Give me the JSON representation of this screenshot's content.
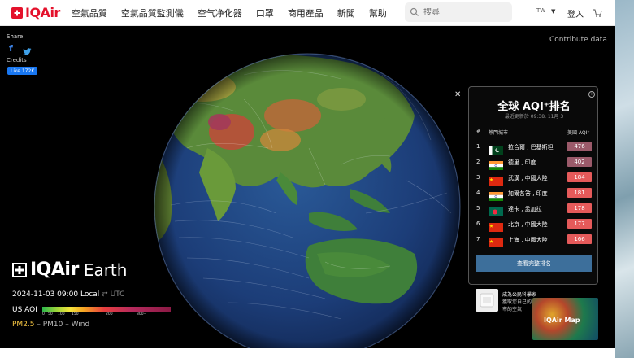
{
  "header": {
    "logo_text": "IQAir",
    "nav": [
      "空氣品質",
      "空氣品質監測儀",
      "空气净化器",
      "口罩",
      "商用產品",
      "新聞",
      "幫助"
    ],
    "search_placeholder": "搜尋",
    "lang": "TW",
    "login": "登入"
  },
  "left": {
    "share": "Share",
    "credits": "Credits",
    "like": "Like 172K",
    "brand": "IQAir",
    "brand_sub": "Earth",
    "datetime": "2024-11-03 09:00 Local",
    "utc": "⇄ UTC",
    "aqi_label": "US AQI",
    "scale_ticks": [
      "0",
      "50",
      "100",
      "150",
      "200",
      "300+"
    ],
    "pollutant_active": "PM2.5",
    "pollutant_rest": " – PM10 – Wind"
  },
  "contribute": "Contribute data",
  "ranking": {
    "title": "全球 AQI⁺排名",
    "updated": "最近更新於 09:38, 11月 3",
    "head_num": "#",
    "head_city": "熱門城市",
    "head_aqi": "美國 AQI⁺",
    "rows": [
      {
        "rank": "1",
        "city": "拉合爾 , 巴基斯坦",
        "aqi": "476",
        "flag": "pk",
        "color": "#9b5a6a"
      },
      {
        "rank": "2",
        "city": "德里 , 印度",
        "aqi": "402",
        "flag": "in",
        "color": "#9b5a6a"
      },
      {
        "rank": "3",
        "city": "武漢 , 中國大陸",
        "aqi": "184",
        "flag": "cn",
        "color": "#e55a5a"
      },
      {
        "rank": "4",
        "city": "加爾各答 , 印度",
        "aqi": "181",
        "flag": "in",
        "color": "#e55a5a"
      },
      {
        "rank": "5",
        "city": "達卡 , 孟加拉",
        "aqi": "178",
        "flag": "bd",
        "color": "#e55a5a"
      },
      {
        "rank": "6",
        "city": "北京 , 中國大陸",
        "aqi": "177",
        "flag": "cn",
        "color": "#e55a5a"
      },
      {
        "rank": "7",
        "city": "上海 , 中國大陸",
        "aqi": "166",
        "flag": "cn",
        "color": "#e55a5a"
      }
    ],
    "button": "查看完整排名"
  },
  "citizen": {
    "title": "成為公民科學家",
    "desc": "獲取您自己的 市的空氣",
    "map_label": "IQAir Map"
  }
}
